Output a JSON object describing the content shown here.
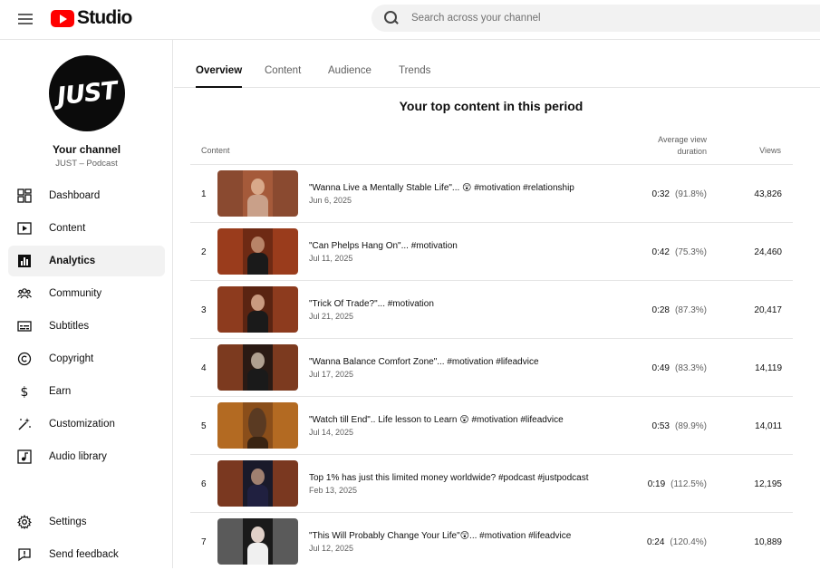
{
  "header": {
    "logo_text": "Studio",
    "search_placeholder": "Search across your channel"
  },
  "sidebar": {
    "avatar_text": "JUST",
    "channel_title": "Your channel",
    "channel_subtitle": "JUST – Podcast",
    "items": [
      {
        "label": "Dashboard",
        "icon": "dashboard-icon"
      },
      {
        "label": "Content",
        "icon": "content-icon"
      },
      {
        "label": "Analytics",
        "icon": "analytics-icon",
        "active": true
      },
      {
        "label": "Community",
        "icon": "community-icon"
      },
      {
        "label": "Subtitles",
        "icon": "subtitles-icon"
      },
      {
        "label": "Copyright",
        "icon": "copyright-icon"
      },
      {
        "label": "Earn",
        "icon": "earn-icon"
      },
      {
        "label": "Customization",
        "icon": "customization-icon"
      },
      {
        "label": "Audio library",
        "icon": "audio-library-icon"
      }
    ],
    "bottom_items": [
      {
        "label": "Settings",
        "icon": "gear-icon"
      },
      {
        "label": "Send feedback",
        "icon": "feedback-icon"
      }
    ]
  },
  "tabs": [
    {
      "label": "Overview",
      "active": true
    },
    {
      "label": "Content"
    },
    {
      "label": "Audience"
    },
    {
      "label": "Trends"
    }
  ],
  "main": {
    "section_title": "Your top content in this period",
    "columns": {
      "content": "Content",
      "avg_view_duration_line1": "Average view",
      "avg_view_duration_line2": "duration",
      "views": "Views"
    },
    "rows": [
      {
        "rank": "1",
        "title": "\"Wanna Live a Mentally Stable Life\"... 😲 #motivation #relationship",
        "date": "Jun 6, 2025",
        "duration": "0:32",
        "percent": "(91.8%)",
        "views": "43,826",
        "thumb_color": "#8a4a30"
      },
      {
        "rank": "2",
        "title": "\"Can Phelps Hang On\"... #motivation",
        "date": "Jul 11, 2025",
        "duration": "0:42",
        "percent": "(75.3%)",
        "views": "24,460",
        "thumb_color": "#9a3c1c"
      },
      {
        "rank": "3",
        "title": "\"Trick Of Trade?\"... #motivation",
        "date": "Jul 21, 2025",
        "duration": "0:28",
        "percent": "(87.3%)",
        "views": "20,417",
        "thumb_color": "#8d3b1e"
      },
      {
        "rank": "4",
        "title": "\"Wanna Balance Comfort Zone\"... #motivation #lifeadvice",
        "date": "Jul 17, 2025",
        "duration": "0:49",
        "percent": "(83.3%)",
        "views": "14,119",
        "thumb_color": "#7c3a1f"
      },
      {
        "rank": "5",
        "title": "\"Watch till End\".. Life lesson to Learn 😲 #motivation #lifeadvice",
        "date": "Jul 14, 2025",
        "duration": "0:53",
        "percent": "(89.9%)",
        "views": "14,011",
        "thumb_color": "#b36a22"
      },
      {
        "rank": "6",
        "title": "Top 1% has just this limited money worldwide? #podcast #justpodcast",
        "date": "Feb 13, 2025",
        "duration": "0:19",
        "percent": "(112.5%)",
        "views": "12,195",
        "thumb_color": "#7a3820"
      },
      {
        "rank": "7",
        "title": "\"This Will Probably Change Your Life\"😲... #motivation #lifeadvice",
        "date": "Jul 12, 2025",
        "duration": "0:24",
        "percent": "(120.4%)",
        "views": "10,889",
        "thumb_color": "#5a5a5a"
      }
    ]
  }
}
